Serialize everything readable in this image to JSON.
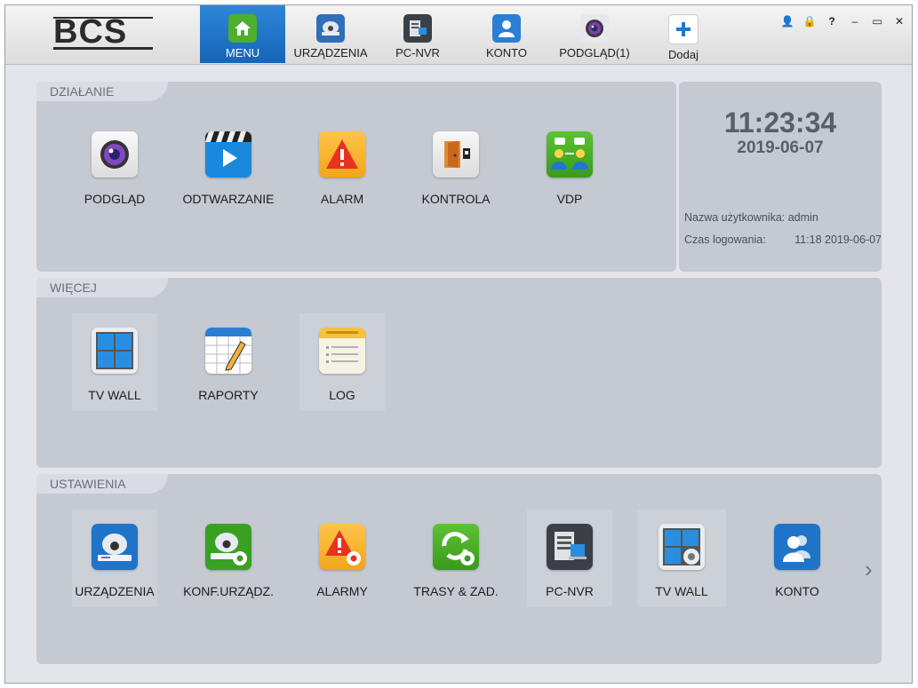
{
  "app": {
    "logo_text": "BCS",
    "nav": [
      {
        "label": "MENU",
        "icon": "home-icon"
      },
      {
        "label": "URZĄDZENIA",
        "icon": "dome-camera-icon"
      },
      {
        "label": "PC-NVR",
        "icon": "pc-nvr-icon"
      },
      {
        "label": "KONTO",
        "icon": "user-icon"
      },
      {
        "label": "PODGLĄD(1)",
        "icon": "camera-lens-icon"
      },
      {
        "label": "Dodaj",
        "icon": "plus-icon"
      }
    ],
    "window_controls": [
      "user-icon",
      "lock-icon",
      "help-icon",
      "minimize-icon",
      "maximize-icon",
      "close-icon"
    ],
    "window_control_glyphs": [
      "👤",
      "🔒",
      "?",
      "–",
      "▭",
      "✕"
    ]
  },
  "dzialanie": {
    "title": "DZIAŁANIE",
    "items": [
      {
        "label": "PODGLĄD",
        "icon": "camera-lens-icon"
      },
      {
        "label": "ODTWARZANIE",
        "icon": "playback-clapper-icon"
      },
      {
        "label": "ALARM",
        "icon": "alarm-warning-icon"
      },
      {
        "label": "KONTROLA",
        "icon": "door-access-icon"
      },
      {
        "label": "VDP",
        "icon": "video-intercom-icon"
      }
    ]
  },
  "status": {
    "time": "11:23:34",
    "date": "2019-06-07",
    "user_label": "Nazwa użytkownika:",
    "user_value": "admin",
    "login_label": "Czas logowania:",
    "login_value": "11:18 2019-06-07"
  },
  "wiecej": {
    "title": "WIĘCEJ",
    "items": [
      {
        "label": "TV WALL",
        "icon": "tv-wall-icon"
      },
      {
        "label": "RAPORTY",
        "icon": "reports-calendar-icon"
      },
      {
        "label": "LOG",
        "icon": "log-notepad-icon"
      }
    ]
  },
  "ustawienia": {
    "title": "USTAWIENIA",
    "items": [
      {
        "label": "URZĄDZENIA",
        "icon": "devices-icon"
      },
      {
        "label": "KONF.URZĄDZ.",
        "icon": "device-config-icon"
      },
      {
        "label": "ALARMY",
        "icon": "alarm-config-icon"
      },
      {
        "label": "TRASY & ZAD.",
        "icon": "tours-tasks-icon"
      },
      {
        "label": "PC-NVR",
        "icon": "pc-nvr-config-icon"
      },
      {
        "label": "TV WALL",
        "icon": "tv-wall-config-icon"
      },
      {
        "label": "KONTO",
        "icon": "account-icon"
      }
    ],
    "next_glyph": "›"
  }
}
